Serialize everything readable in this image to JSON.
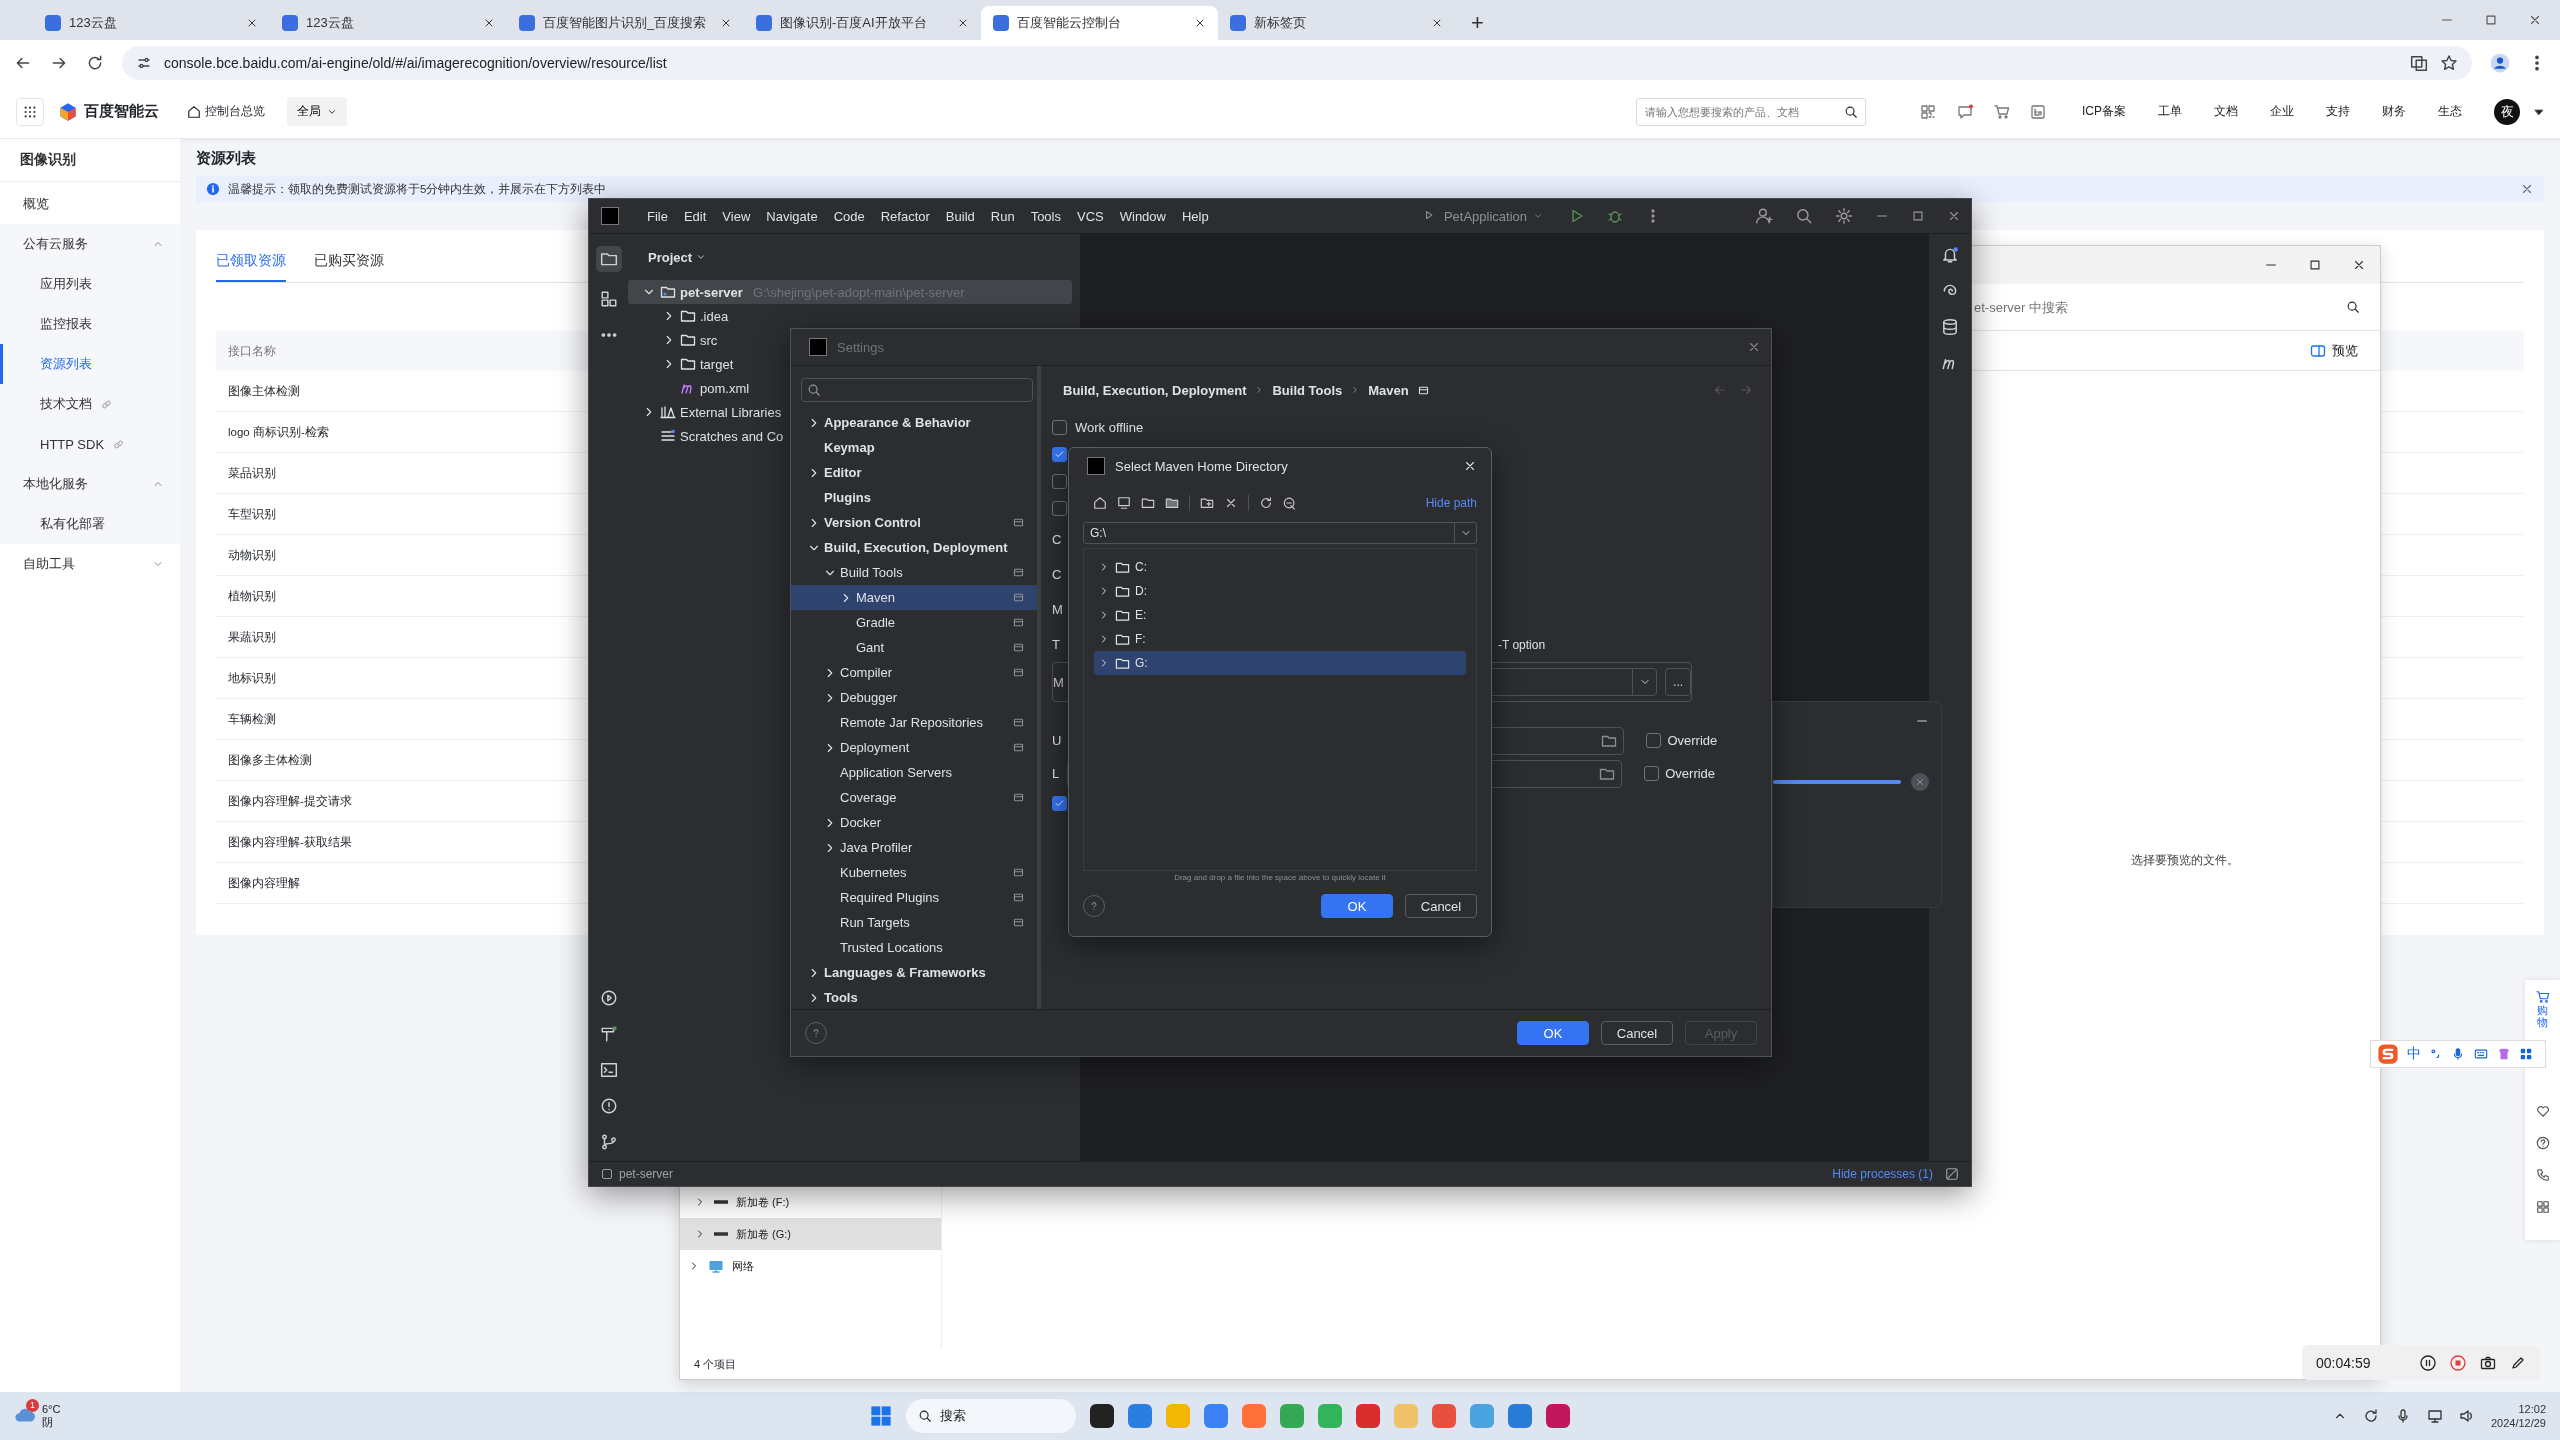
{
  "browser": {
    "tabs": [
      {
        "label": "123云盘",
        "selected": false
      },
      {
        "label": "123云盘",
        "selected": false
      },
      {
        "label": "百度智能图片识别_百度搜索",
        "selected": false
      },
      {
        "label": "图像识别-百度AI开放平台",
        "selected": false
      },
      {
        "label": "百度智能云控制台",
        "selected": true
      },
      {
        "label": "新标签页",
        "selected": false
      }
    ],
    "new_tab": "+",
    "url": "console.bce.baidu.com/ai-engine/old/#/ai/imagerecognition/overview/resource/list"
  },
  "console_header": {
    "logo": "百度智能云",
    "home": "控制台总览",
    "region": "全局",
    "search": {
      "placeholder": "请输入您想要搜索的产品、文档"
    },
    "links": [
      "ICP备案",
      "工单",
      "文档",
      "企业",
      "支持",
      "财务",
      "生态"
    ],
    "avatar": "夜"
  },
  "sidebar": {
    "title": "图像识别",
    "items": [
      {
        "label": "概览",
        "kind": "item",
        "selected": false
      },
      {
        "label": "公有云服务",
        "kind": "group",
        "expanded": true,
        "children": [
          {
            "label": "应用列表",
            "selected": false,
            "external": false
          },
          {
            "label": "监控报表",
            "selected": false,
            "external": false
          },
          {
            "label": "资源列表",
            "selected": true,
            "external": false
          },
          {
            "label": "技术文档",
            "selected": false,
            "external": true
          },
          {
            "label": "HTTP SDK",
            "selected": false,
            "external": true
          }
        ]
      },
      {
        "label": "本地化服务",
        "kind": "group",
        "expanded": true,
        "children": [
          {
            "label": "私有化部署",
            "selected": false,
            "external": false
          }
        ]
      },
      {
        "label": "自助工具",
        "kind": "group",
        "expanded": false
      }
    ]
  },
  "content": {
    "title": "资源列表",
    "notice": "温馨提示：领取的免费测试资源将于5分钟内生效，并展示在下方列表中",
    "tabs": [
      {
        "label": "已领取资源",
        "selected": true
      },
      {
        "label": "已购买资源",
        "selected": false
      }
    ],
    "table": {
      "columns": [
        "接口名称"
      ],
      "rows": [
        [
          "图像主体检测"
        ],
        [
          "logo 商标识别-检索"
        ],
        [
          "菜品识别"
        ],
        [
          "车型识别"
        ],
        [
          "动物识别"
        ],
        [
          "植物识别"
        ],
        [
          "果蔬识别"
        ],
        [
          "地标识别"
        ],
        [
          "车辆检测"
        ],
        [
          "图像多主体检测"
        ],
        [
          "图像内容理解-提交请求"
        ],
        [
          "图像内容理解-获取结果"
        ],
        [
          "图像内容理解"
        ]
      ]
    }
  },
  "explorer": {
    "search": {
      "placeholder": "et-server 中搜索"
    },
    "preview_button": "预览",
    "nav": [
      {
        "label": "新加卷 (F:)",
        "kind": "drive",
        "selected": false,
        "expanded": false
      },
      {
        "label": "新加卷 (G:)",
        "kind": "drive",
        "selected": true,
        "expanded": false
      },
      {
        "label": "网络",
        "kind": "network",
        "selected": false,
        "expanded": false
      }
    ],
    "preview_hint": "选择要预览的文件。",
    "status": "4 个项目"
  },
  "ide": {
    "menu": [
      "File",
      "Edit",
      "View",
      "Navigate",
      "Code",
      "Refactor",
      "Build",
      "Run",
      "Tools",
      "VCS",
      "Window",
      "Help"
    ],
    "run_config": "PetApplication",
    "project_label": "Project",
    "tree": [
      {
        "label": "pet-server",
        "path": "G:\\shejing\\pet-adopt-main\\pet-server",
        "kind": "module",
        "expanded": true,
        "selected": true,
        "children": [
          {
            "label": ".idea",
            "kind": "folder",
            "expanded": false,
            "selected": false
          },
          {
            "label": "src",
            "kind": "folder",
            "expanded": false,
            "selected": false
          },
          {
            "label": "target",
            "kind": "folder",
            "expanded": false,
            "selected": false
          },
          {
            "label": "pom.xml",
            "kind": "maven",
            "selected": false
          }
        ]
      },
      {
        "label": "External Libraries",
        "kind": "library",
        "expanded": false,
        "selected": false
      },
      {
        "label": "Scratches and Co",
        "kind": "scratch",
        "selected": false
      }
    ],
    "status_project": "pet-server",
    "hide_processes": "Hide processes (1)",
    "progress": {
      "level": 1
    }
  },
  "settings": {
    "title": "Settings",
    "tree": [
      {
        "label": "Appearance & Behavior",
        "expanded": false,
        "selected": false,
        "project_level": false
      },
      {
        "label": "Keymap",
        "selected": false,
        "project_level": false
      },
      {
        "label": "Editor",
        "expanded": false,
        "selected": false,
        "project_level": false
      },
      {
        "label": "Plugins",
        "selected": false,
        "project_level": false
      },
      {
        "label": "Version Control",
        "expanded": false,
        "selected": false,
        "project_level": true
      },
      {
        "label": "Build, Execution, Deployment",
        "expanded": true,
        "selected": false,
        "project_level": false,
        "children": [
          {
            "label": "Build Tools",
            "expanded": true,
            "selected": false,
            "project_level": true,
            "children": [
              {
                "label": "Maven",
                "expanded": false,
                "selected": true,
                "project_level": true
              },
              {
                "label": "Gradle",
                "selected": false,
                "project_level": true
              },
              {
                "label": "Gant",
                "selected": false,
                "project_level": true
              }
            ]
          },
          {
            "label": "Compiler",
            "expanded": false,
            "selected": false,
            "project_level": true
          },
          {
            "label": "Debugger",
            "expanded": false,
            "selected": false,
            "project_level": false
          },
          {
            "label": "Remote Jar Repositories",
            "selected": false,
            "project_level": true
          },
          {
            "label": "Deployment",
            "expanded": false,
            "selected": false,
            "project_level": true
          },
          {
            "label": "Application Servers",
            "selected": false,
            "project_level": false
          },
          {
            "label": "Coverage",
            "selected": false,
            "project_level": true
          },
          {
            "label": "Docker",
            "expanded": false,
            "selected": false,
            "project_level": false
          },
          {
            "label": "Java Profiler",
            "expanded": false,
            "selected": false,
            "project_level": false
          },
          {
            "label": "Kubernetes",
            "selected": false,
            "project_level": true
          },
          {
            "label": "Required Plugins",
            "selected": false,
            "project_level": true
          },
          {
            "label": "Run Targets",
            "selected": false,
            "project_level": true
          },
          {
            "label": "Trusted Locations",
            "selected": false,
            "project_level": false
          }
        ]
      },
      {
        "label": "Languages & Frameworks",
        "expanded": false,
        "selected": false,
        "project_level": false
      },
      {
        "label": "Tools",
        "expanded": false,
        "selected": false,
        "project_level": false
      }
    ],
    "breadcrumb": [
      "Build, Execution, Deployment",
      "Build Tools",
      "Maven"
    ],
    "rows": [
      {
        "kind": "check",
        "label": "Work offline",
        "checked": false
      },
      {
        "kind": "check",
        "checked": true
      },
      {
        "kind": "check",
        "checked": false
      },
      {
        "kind": "check",
        "checked": false
      },
      {
        "kind": "label",
        "label": "C"
      },
      {
        "kind": "label",
        "label": "C"
      },
      {
        "kind": "label",
        "label": "M"
      },
      {
        "kind": "label",
        "label": "T",
        "tail": "-T option"
      },
      {
        "kind": "combo",
        "label": "M",
        "browse": "..."
      },
      {
        "kind": "path",
        "label": "U",
        "override": {
          "label": "Override",
          "checked": false
        }
      },
      {
        "kind": "path",
        "label": "L",
        "override": {
          "label": "Override",
          "checked": false
        }
      },
      {
        "kind": "check",
        "checked": true
      }
    ],
    "buttons": [
      {
        "label": "OK",
        "default": true,
        "disabled": false
      },
      {
        "label": "Cancel",
        "default": false,
        "disabled": false
      },
      {
        "label": "Apply",
        "default": false,
        "disabled": true
      }
    ]
  },
  "maven_dialog": {
    "title": "Select Maven Home Directory",
    "hide_path": "Hide path",
    "path": "G:\\",
    "drives": [
      {
        "label": "C:",
        "selected": false,
        "expanded": false
      },
      {
        "label": "D:",
        "selected": false,
        "expanded": false
      },
      {
        "label": "E:",
        "selected": false,
        "expanded": false
      },
      {
        "label": "F:",
        "selected": false,
        "expanded": false
      },
      {
        "label": "G:",
        "selected": true,
        "expanded": false
      }
    ],
    "hint": "Drag and drop a file into the space above to quickly locate it",
    "buttons": [
      {
        "label": "OK",
        "default": true
      },
      {
        "label": "Cancel",
        "default": false
      }
    ]
  },
  "recorder": {
    "time": "00:04:59"
  },
  "ime": {
    "mode": "中"
  },
  "float_bar": {
    "cart": "购物"
  },
  "taskbar": {
    "weather": {
      "temp": "6°C",
      "condition": "阴",
      "badge": "1"
    },
    "search": "搜索",
    "time": "12:02",
    "date": "2024/12/29"
  }
}
